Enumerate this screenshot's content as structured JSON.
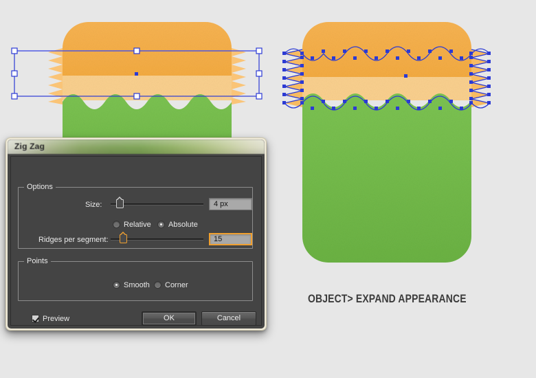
{
  "app": {
    "background_color": "#e7e7e7"
  },
  "dialog": {
    "title": "Zig Zag",
    "groups": {
      "options": {
        "label": "Options",
        "size": {
          "label": "Size:",
          "value": "4 px",
          "slider_percent": 6,
          "focused": false
        },
        "mode": {
          "options": [
            {
              "label": "Relative",
              "selected": false
            },
            {
              "label": "Absolute",
              "selected": true
            }
          ]
        },
        "ridges": {
          "label": "Ridges per segment:",
          "value": "15",
          "slider_percent": 10,
          "focused": true
        }
      },
      "points": {
        "label": "Points",
        "options": [
          {
            "label": "Smooth",
            "selected": true
          },
          {
            "label": "Corner",
            "selected": false
          }
        ]
      }
    },
    "preview": {
      "label": "Preview",
      "checked": true
    },
    "buttons": {
      "ok": "OK",
      "cancel": "Cancel"
    },
    "accent_color": "#f0a030",
    "panel_color": "#444444"
  },
  "caption": {
    "text": "OBJECT> EXPAND APPEARANCE"
  },
  "artwork": {
    "colors": {
      "orange": "#f5ad44",
      "light_orange": "#fad08e",
      "green": "#76bf4c",
      "anchor_blue": "#2b3ad4",
      "handle_fill": "#ffffff"
    },
    "left_shape": {
      "name": "zigzag-preview-shape",
      "selection_visible": true
    },
    "right_shape": {
      "name": "expanded-appearance-shape",
      "selection_visible": true
    }
  }
}
